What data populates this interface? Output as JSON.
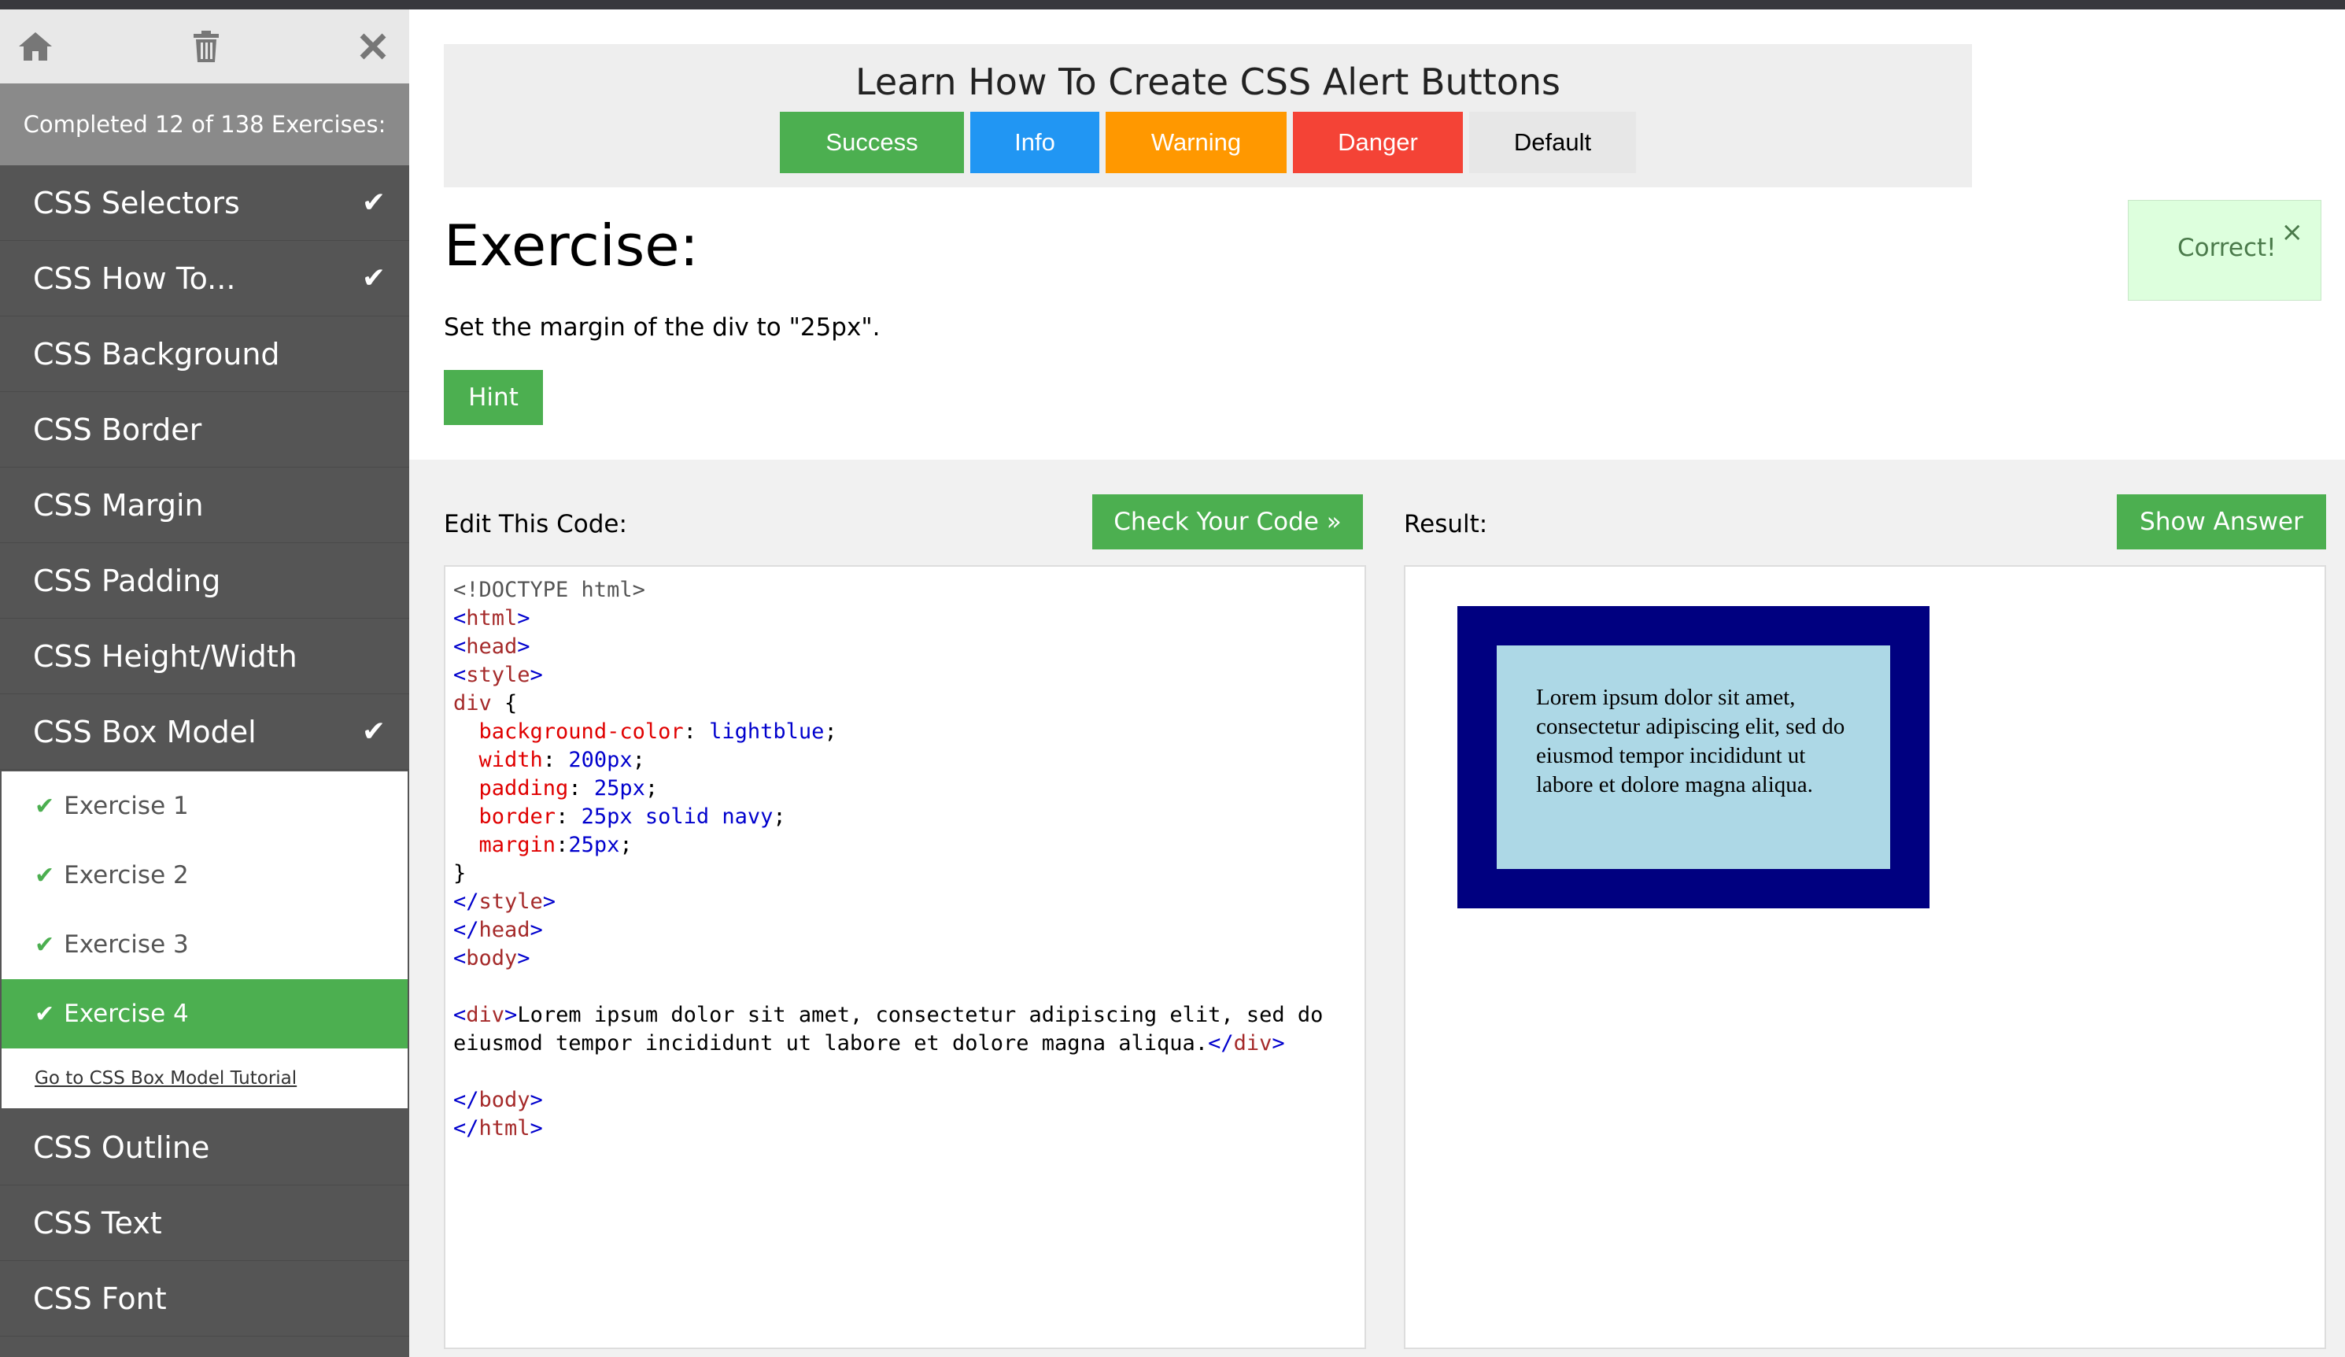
{
  "sidebar": {
    "progress": "Completed 12 of 138 Exercises:",
    "items_top": [
      {
        "label": "CSS Selectors",
        "done": true
      },
      {
        "label": "CSS How To...",
        "done": true
      },
      {
        "label": "CSS Background",
        "done": false
      },
      {
        "label": "CSS Border",
        "done": false
      },
      {
        "label": "CSS Margin",
        "done": false
      },
      {
        "label": "CSS Padding",
        "done": false
      },
      {
        "label": "CSS Height/Width",
        "done": false
      },
      {
        "label": "CSS Box Model",
        "done": true
      }
    ],
    "sub_items": [
      {
        "label": "Exercise 1"
      },
      {
        "label": "Exercise 2"
      },
      {
        "label": "Exercise 3"
      },
      {
        "label": "Exercise 4"
      }
    ],
    "tutorial_link": "Go to CSS Box Model Tutorial",
    "items_bottom": [
      {
        "label": "CSS Outline"
      },
      {
        "label": "CSS Text"
      },
      {
        "label": "CSS Font"
      }
    ]
  },
  "alert_demo": {
    "title": "Learn How To Create CSS Alert Buttons",
    "buttons": {
      "success": "Success",
      "info": "Info",
      "warning": "Warning",
      "danger": "Danger",
      "default": "Default"
    }
  },
  "exercise": {
    "heading": "Exercise:",
    "instruction": "Set the margin of the div to \"25px\".",
    "hint": "Hint"
  },
  "feedback": {
    "message": "Correct!",
    "close": "×"
  },
  "editor": {
    "label": "Edit This Code:",
    "check_button": "Check Your Code »",
    "result_label": "Result:",
    "answer_button": "Show Answer",
    "code": {
      "l1": "<!DOCTYPE html>",
      "l2": "html",
      "l3": "head",
      "l4": "style",
      "l5_sel": "div",
      "l5_rest": " {",
      "l6_prop": "background-color",
      "l6_val": "lightblue",
      "l7_prop": "width",
      "l7_val": "200px",
      "l8_prop": "padding",
      "l8_val": "25px",
      "l9_prop": "border",
      "l9_val": "25px solid navy",
      "l10_prop": "margin",
      "l10_val": "25px",
      "l11": "}",
      "l12": "style",
      "l13": "head",
      "l14": "body",
      "l16_tag": "div",
      "l16_text": "Lorem ipsum dolor sit amet, consectetur adipiscing elit, sed do",
      "l17_text": "eiusmod tempor incididunt ut labore et dolore magna aliqua.",
      "l17_tag": "div",
      "l19": "body",
      "l20": "html"
    },
    "result_text": "Lorem ipsum dolor sit amet, consectetur adipiscing elit, sed do eiusmod tempor incididunt ut labore et dolore magna aliqua."
  }
}
